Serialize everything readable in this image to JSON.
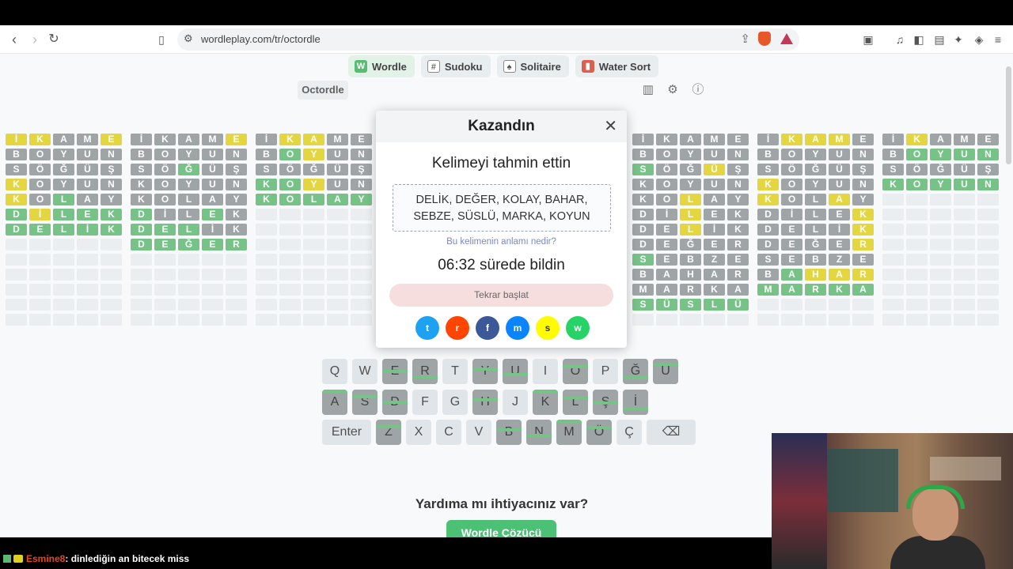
{
  "browser": {
    "url": "wordleplay.com/tr/octordle"
  },
  "gametabs": [
    {
      "label": "Wordle",
      "icon": "W"
    },
    {
      "label": "Sudoku",
      "icon": "#"
    },
    {
      "label": "Solitaire",
      "icon": "♠"
    },
    {
      "label": "Water Sort",
      "icon": "▮"
    }
  ],
  "mode": "Octordle",
  "boards": [
    {
      "rows": [
        "İKAME",
        "BOYUN",
        "SÖĞÜŞ",
        "KOYUN",
        "KOLAY",
        "DİLEK",
        "DELİK",
        "     ",
        "     ",
        "     ",
        "     ",
        "     ",
        "     "
      ],
      "marks": [
        "yyxxy",
        "xxxxx",
        "xxxxx",
        "yxxxx",
        "yxgxx",
        "gyggg",
        "ggggg",
        "eeeee",
        "eeeee",
        "eeeee",
        "eeeee",
        "eeeee",
        "eeeee"
      ]
    },
    {
      "rows": [
        "İKAME",
        "BOYUN",
        "SÖĞÜŞ",
        "KOYUN",
        "KOLAY",
        "DİLEK",
        "DELİK",
        "DEĞER",
        "     ",
        "     ",
        "     ",
        "     ",
        "     "
      ],
      "marks": [
        "xxxxy",
        "xxxxx",
        "xxgxx",
        "xxxxx",
        "xxxxx",
        "gxxgx",
        "gggxx",
        "ggggg",
        "eeeee",
        "eeeee",
        "eeeee",
        "eeeee",
        "eeeee"
      ]
    },
    {
      "rows": [
        "İKAME",
        "BOYUN",
        "SÖĞÜŞ",
        "KOYUN",
        "KOLAY",
        "     ",
        "     ",
        "     ",
        "     ",
        "     ",
        "     ",
        "     ",
        "     "
      ],
      "marks": [
        "xyyxx",
        "xgyxx",
        "xxxxx",
        "ggyxx",
        "ggggg",
        "eeeee",
        "eeeee",
        "eeeee",
        "eeeee",
        "eeeee",
        "eeeee",
        "eeeee",
        "eeeee"
      ]
    },
    {
      "rows": [
        "İKAME",
        "BOYUN",
        "SÖĞÜŞ",
        "KOYUN",
        "KOLAY",
        "DİLEK",
        "DELİK",
        "DEĞER",
        "SEBZE",
        "BAHAR",
        "MARKA",
        "SÜSLÜ",
        "     "
      ],
      "marks": [
        "xxxxx",
        "xxxxx",
        "gxxyx",
        "xxxxx",
        "xxyxx",
        "xxyxx",
        "xxyxx",
        "xxxxx",
        "gxxxx",
        "xxxxx",
        "xxxxx",
        "ggggg",
        "eeeee"
      ]
    },
    {
      "rows": [
        "İKAME",
        "BOYUN",
        "SÖĞÜŞ",
        "KOYUN",
        "KOLAY",
        "DİLEK",
        "DELİK",
        "DEĞER",
        "SEBZE",
        "BAHAR",
        "MARKA",
        "     ",
        "     "
      ],
      "marks": [
        "xyyyx",
        "xxxxx",
        "xxxxx",
        "yxxxx",
        "yxxyx",
        "xxxxy",
        "xxxxy",
        "xxxxy",
        "xxxxx",
        "xgyyy",
        "ggggg",
        "eeeee",
        "eeeee"
      ]
    },
    {
      "rows": [
        "İKAME",
        "BOYUN",
        "SÖĞÜŞ",
        "KOYUN",
        "     ",
        "     ",
        "     ",
        "     ",
        "     ",
        "     ",
        "     ",
        "     ",
        "     "
      ],
      "marks": [
        "xyxxx",
        "xgggg",
        "xxxxx",
        "ggggg",
        "eeeee",
        "eeeee",
        "eeeee",
        "eeeee",
        "eeeee",
        "eeeee",
        "eeeee",
        "eeeee",
        "eeeee"
      ]
    }
  ],
  "modal": {
    "title": "Kazandın",
    "subtitle": "Kelimeyi tahmin ettin",
    "words_line1": "DELİK, DEĞER, KOLAY, BAHAR,",
    "words_line2": "SEBZE, SÜSLÜ, MARKA, KOYUN",
    "meaning_link": "Bu kelimenin anlamı nedir?",
    "time_msg": "06:32 sürede bildin",
    "restart": "Tekrar başlat",
    "share_icons": [
      {
        "name": "twitter-share-icon",
        "glyph": "t",
        "color": "#1da1f2"
      },
      {
        "name": "reddit-share-icon",
        "glyph": "r",
        "color": "#ff4500"
      },
      {
        "name": "facebook-share-icon",
        "glyph": "f",
        "color": "#3b5998"
      },
      {
        "name": "messenger-share-icon",
        "glyph": "m",
        "color": "#0a84ff"
      },
      {
        "name": "snapchat-share-icon",
        "glyph": "s",
        "color": "#fffc00"
      },
      {
        "name": "whatsapp-share-icon",
        "glyph": "w",
        "color": "#25d366"
      }
    ]
  },
  "keyboard": {
    "row1": [
      "Q",
      "W",
      "E",
      "R",
      "T",
      "Y",
      "U",
      "I",
      "O",
      "P",
      "Ğ",
      "Ü"
    ],
    "row2": [
      "A",
      "S",
      "D",
      "F",
      "G",
      "H",
      "J",
      "K",
      "L",
      "Ş",
      "İ"
    ],
    "row3": [
      "Enter",
      "Z",
      "X",
      "C",
      "V",
      "B",
      "N",
      "M",
      "Ö",
      "Ç",
      "⌫"
    ],
    "dark": [
      "E",
      "R",
      "Y",
      "U",
      "O",
      "Ğ",
      "Ü",
      "A",
      "S",
      "D",
      "H",
      "K",
      "L",
      "Ş",
      "İ",
      "Z",
      "B",
      "N",
      "M",
      "Ö"
    ]
  },
  "help_title": "Yardıma mı ihtiyacınız var?",
  "solver_button": "Wordle Çözücü",
  "chat": {
    "user": "Esmine8",
    "text": ": dinlediğin an bitecek miss"
  }
}
